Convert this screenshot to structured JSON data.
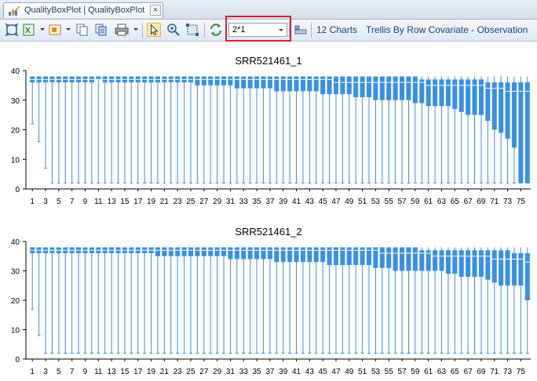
{
  "tab": {
    "title": "QualityBoxPlot | QualityBoxPlot",
    "close": "×"
  },
  "toolbar": {
    "layout_value": "2*1",
    "charts_count": "12 Charts",
    "trellis_label": "Trellis By Row Covariate - Observation",
    "icons": [
      "fit-window-icon",
      "export-excel-icon",
      "export-image-icon",
      "copy-icon",
      "copy-data-icon",
      "print-icon",
      "pointer-icon",
      "zoom-icon",
      "select-region-icon",
      "refresh-icon",
      "layout-icon"
    ]
  },
  "colors": {
    "box": "#3a8fe3",
    "whisker": "#3a8fe3",
    "median": "#ffffff",
    "axis": "#000000"
  },
  "chart_data": [
    {
      "type": "box",
      "title": "SRR521461_1",
      "ylim": [
        0,
        40
      ],
      "yticks": [
        0,
        10,
        20,
        30,
        40
      ],
      "xtick_labels": [
        "1",
        "3",
        "5",
        "7",
        "9",
        "11",
        "13",
        "15",
        "17",
        "19",
        "21",
        "23",
        "25",
        "27",
        "29",
        "31",
        "33",
        "35",
        "37",
        "39",
        "41",
        "43",
        "45",
        "47",
        "49",
        "51",
        "53",
        "55",
        "57",
        "59",
        "61",
        "63",
        "65",
        "67",
        "69",
        "71",
        "73",
        "75"
      ],
      "x": [
        1,
        2,
        3,
        4,
        5,
        6,
        7,
        8,
        9,
        10,
        11,
        12,
        13,
        14,
        15,
        16,
        17,
        18,
        19,
        20,
        21,
        22,
        23,
        24,
        25,
        26,
        27,
        28,
        29,
        30,
        31,
        32,
        33,
        34,
        35,
        36,
        37,
        38,
        39,
        40,
        41,
        42,
        43,
        44,
        45,
        46,
        47,
        48,
        49,
        50,
        51,
        52,
        53,
        54,
        55,
        56,
        57,
        58,
        59,
        60,
        61,
        62,
        63,
        64,
        65,
        66,
        67,
        68,
        69,
        70,
        71,
        72,
        73,
        74,
        75,
        76
      ],
      "q1": [
        36,
        36,
        36,
        36,
        36,
        36,
        36,
        36,
        36,
        36,
        37,
        36,
        36,
        36,
        36,
        36,
        36,
        36,
        36,
        36,
        36,
        36,
        36,
        36,
        36,
        35,
        35,
        35,
        35,
        35,
        35,
        34,
        34,
        34,
        34,
        34,
        34,
        33,
        33,
        33,
        33,
        33,
        33,
        33,
        32,
        32,
        32,
        32,
        32,
        31,
        31,
        31,
        30,
        30,
        30,
        30,
        30,
        30,
        29,
        29,
        28,
        28,
        28,
        28,
        27,
        26,
        25,
        25,
        25,
        23,
        20,
        19,
        17,
        14,
        2,
        2
      ],
      "q3": [
        38,
        38,
        38,
        38,
        38,
        38,
        38,
        38,
        38,
        38,
        38,
        38,
        38,
        38,
        38,
        38,
        38,
        38,
        38,
        38,
        38,
        38,
        38,
        38,
        38,
        38,
        38,
        38,
        38,
        38,
        38,
        38,
        38,
        38,
        38,
        38,
        38,
        38,
        38,
        38,
        38,
        38,
        38,
        38,
        38,
        38,
        38,
        38,
        38,
        38,
        38,
        38,
        38,
        38,
        38,
        38,
        38,
        38,
        38,
        37,
        37,
        37,
        37,
        37,
        37,
        37,
        37,
        37,
        37,
        36,
        36,
        36,
        36,
        36,
        36,
        36
      ],
      "median": [
        37,
        37,
        37,
        37,
        37,
        37,
        37,
        37,
        37,
        37,
        37,
        37,
        37,
        37,
        37,
        37,
        37,
        37,
        37,
        37,
        37,
        37,
        37,
        37,
        37,
        37,
        37,
        37,
        37,
        37,
        37,
        37,
        37,
        37,
        37,
        37,
        37,
        37,
        37,
        37,
        37,
        37,
        37,
        37,
        37,
        37,
        36,
        36,
        36,
        36,
        36,
        36,
        36,
        36,
        36,
        36,
        36,
        36,
        36,
        36,
        35,
        35,
        35,
        35,
        35,
        35,
        35,
        35,
        35,
        34,
        34,
        34,
        33,
        33,
        33,
        33
      ],
      "whisker_low": [
        22,
        16,
        7,
        2,
        2,
        2,
        2,
        2,
        2,
        2,
        2,
        2,
        2,
        2,
        2,
        2,
        2,
        2,
        2,
        2,
        2,
        2,
        2,
        2,
        2,
        2,
        2,
        2,
        2,
        2,
        2,
        2,
        2,
        2,
        2,
        2,
        2,
        2,
        2,
        2,
        2,
        2,
        2,
        2,
        2,
        2,
        2,
        2,
        2,
        2,
        2,
        2,
        2,
        2,
        2,
        2,
        2,
        2,
        2,
        2,
        2,
        2,
        2,
        2,
        2,
        2,
        2,
        2,
        2,
        2,
        2,
        2,
        2,
        2,
        2,
        2
      ],
      "whisker_high": [
        38,
        38,
        38,
        38,
        38,
        38,
        38,
        38,
        38,
        38,
        38,
        38,
        38,
        38,
        38,
        38,
        38,
        38,
        38,
        38,
        38,
        38,
        38,
        38,
        38,
        38,
        38,
        38,
        38,
        38,
        38,
        38,
        38,
        38,
        38,
        38,
        38,
        38,
        38,
        38,
        38,
        38,
        38,
        38,
        38,
        38,
        38,
        38,
        38,
        38,
        38,
        38,
        38,
        38,
        38,
        38,
        38,
        38,
        38,
        38,
        38,
        38,
        38,
        38,
        38,
        38,
        38,
        38,
        38,
        38,
        38,
        38,
        38,
        38,
        38,
        38
      ],
      "grid": false
    },
    {
      "type": "box",
      "title": "SRR521461_2",
      "ylim": [
        0,
        40
      ],
      "yticks": [
        0,
        10,
        20,
        30,
        40
      ],
      "xtick_labels": [
        "1",
        "3",
        "5",
        "7",
        "9",
        "11",
        "13",
        "15",
        "17",
        "19",
        "21",
        "23",
        "25",
        "27",
        "29",
        "31",
        "33",
        "35",
        "37",
        "39",
        "41",
        "43",
        "45",
        "47",
        "49",
        "51",
        "53",
        "55",
        "57",
        "59",
        "61",
        "63",
        "65",
        "67",
        "69",
        "71",
        "73",
        "75"
      ],
      "x": [
        1,
        2,
        3,
        4,
        5,
        6,
        7,
        8,
        9,
        10,
        11,
        12,
        13,
        14,
        15,
        16,
        17,
        18,
        19,
        20,
        21,
        22,
        23,
        24,
        25,
        26,
        27,
        28,
        29,
        30,
        31,
        32,
        33,
        34,
        35,
        36,
        37,
        38,
        39,
        40,
        41,
        42,
        43,
        44,
        45,
        46,
        47,
        48,
        49,
        50,
        51,
        52,
        53,
        54,
        55,
        56,
        57,
        58,
        59,
        60,
        61,
        62,
        63,
        64,
        65,
        66,
        67,
        68,
        69,
        70,
        71,
        72,
        73,
        74,
        75,
        76
      ],
      "q1": [
        36,
        36,
        36,
        36,
        36,
        36,
        36,
        36,
        36,
        36,
        36,
        36,
        36,
        36,
        36,
        36,
        36,
        36,
        36,
        35,
        35,
        35,
        35,
        35,
        35,
        35,
        35,
        35,
        35,
        35,
        34,
        34,
        34,
        34,
        34,
        34,
        34,
        33,
        33,
        33,
        33,
        33,
        33,
        33,
        33,
        32,
        32,
        32,
        32,
        32,
        32,
        32,
        31,
        31,
        31,
        30,
        30,
        30,
        30,
        30,
        30,
        30,
        30,
        29,
        29,
        28,
        28,
        28,
        28,
        27,
        26,
        25,
        25,
        25,
        25,
        20
      ],
      "q3": [
        38,
        38,
        38,
        38,
        38,
        38,
        38,
        38,
        38,
        38,
        38,
        38,
        38,
        38,
        38,
        38,
        38,
        38,
        38,
        38,
        38,
        38,
        38,
        38,
        38,
        38,
        38,
        38,
        38,
        38,
        38,
        38,
        38,
        38,
        38,
        38,
        38,
        38,
        38,
        38,
        38,
        38,
        38,
        38,
        38,
        38,
        38,
        38,
        38,
        38,
        38,
        38,
        38,
        38,
        38,
        38,
        38,
        38,
        38,
        37,
        37,
        37,
        37,
        37,
        37,
        37,
        37,
        37,
        37,
        37,
        37,
        37,
        37,
        36,
        36,
        36
      ],
      "median": [
        37,
        37,
        37,
        37,
        37,
        37,
        37,
        37,
        37,
        37,
        37,
        37,
        37,
        37,
        37,
        37,
        37,
        37,
        37,
        37,
        37,
        37,
        37,
        37,
        37,
        37,
        37,
        37,
        37,
        37,
        37,
        37,
        37,
        37,
        37,
        37,
        37,
        37,
        37,
        37,
        37,
        37,
        37,
        37,
        37,
        37,
        37,
        37,
        37,
        37,
        37,
        37,
        37,
        36,
        36,
        36,
        36,
        36,
        36,
        36,
        36,
        35,
        35,
        35,
        35,
        35,
        35,
        35,
        35,
        35,
        34,
        34,
        34,
        34,
        34,
        33
      ],
      "whisker_low": [
        17,
        8,
        2,
        2,
        2,
        2,
        2,
        2,
        2,
        2,
        2,
        2,
        2,
        2,
        2,
        2,
        2,
        2,
        2,
        2,
        2,
        2,
        2,
        2,
        2,
        2,
        2,
        2,
        2,
        2,
        2,
        2,
        2,
        2,
        2,
        2,
        2,
        2,
        2,
        2,
        2,
        2,
        2,
        2,
        2,
        2,
        2,
        2,
        2,
        2,
        2,
        2,
        2,
        2,
        2,
        2,
        2,
        2,
        2,
        2,
        2,
        2,
        2,
        2,
        2,
        2,
        2,
        2,
        2,
        2,
        2,
        2,
        2,
        2,
        2,
        2
      ],
      "whisker_high": [
        38,
        38,
        38,
        38,
        38,
        38,
        38,
        38,
        38,
        38,
        38,
        38,
        38,
        38,
        38,
        38,
        38,
        38,
        38,
        38,
        38,
        38,
        38,
        38,
        38,
        38,
        38,
        38,
        38,
        38,
        38,
        38,
        38,
        38,
        38,
        38,
        38,
        38,
        38,
        38,
        38,
        38,
        38,
        38,
        38,
        38,
        38,
        38,
        38,
        38,
        38,
        38,
        38,
        38,
        38,
        38,
        38,
        38,
        38,
        38,
        38,
        38,
        38,
        38,
        38,
        38,
        38,
        38,
        38,
        38,
        38,
        38,
        38,
        38,
        38,
        38
      ],
      "grid": false
    }
  ]
}
